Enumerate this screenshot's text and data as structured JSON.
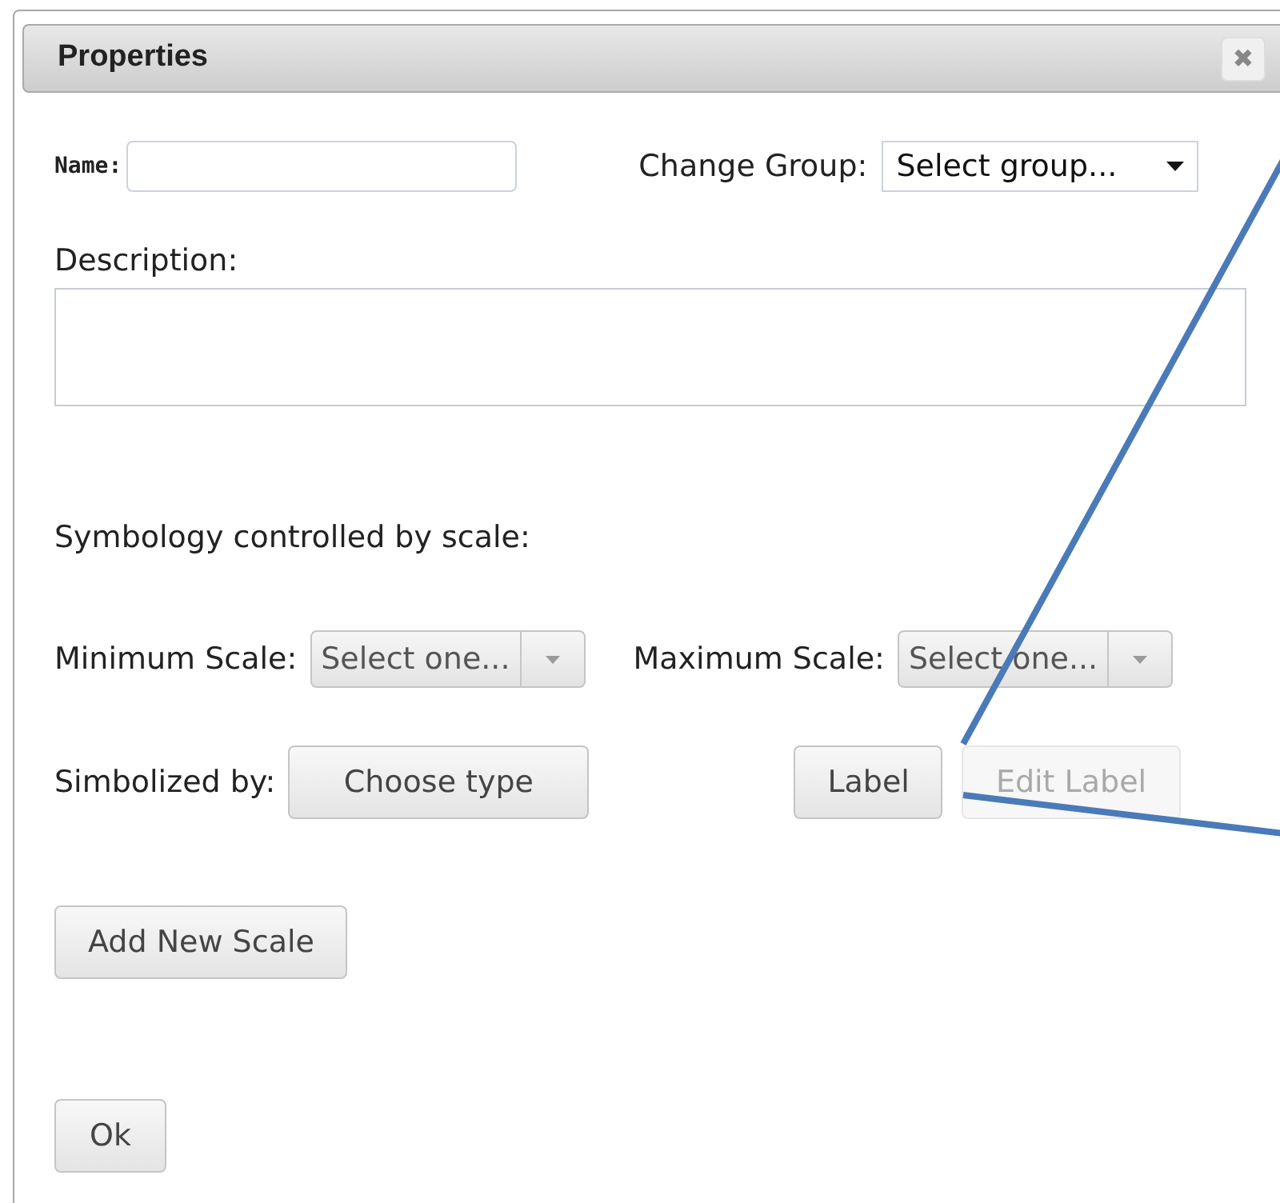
{
  "dialog": {
    "title": "Properties",
    "close_glyph": "✖"
  },
  "name_field": {
    "label": "Name:"
  },
  "group_select": {
    "label": "Change Group:",
    "value": "Select group..."
  },
  "description": {
    "label": "Description:"
  },
  "symbology_heading": "Symbology controlled by scale:",
  "scale_selects": [
    {
      "label": "Minimum Scale:",
      "value": "Select one..."
    },
    {
      "label": "Maximum Scale:",
      "value": "Select one..."
    }
  ],
  "symbolized": {
    "label": "Simbolized by:",
    "choose_button": "Choose type",
    "buttons": [
      {
        "label": "Label",
        "disabled": false
      },
      {
        "label": "Edit Label",
        "disabled": true
      }
    ]
  },
  "add_scale_button": "Add New Scale",
  "ok_button": "Ok"
}
